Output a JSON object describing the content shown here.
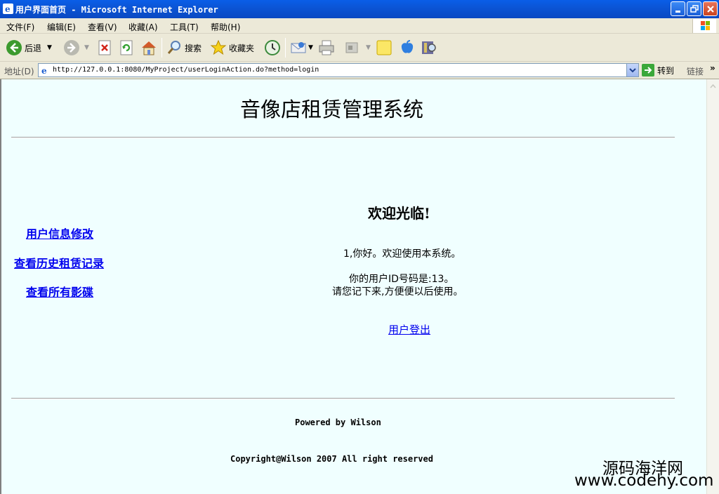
{
  "window": {
    "title": "用户界面首页 - Microsoft Internet Explorer"
  },
  "menu": {
    "items": [
      "文件(F)",
      "编辑(E)",
      "查看(V)",
      "收藏(A)",
      "工具(T)",
      "帮助(H)"
    ]
  },
  "toolbar": {
    "back_label": "后退",
    "search_label": "搜索",
    "favorites_label": "收藏夹"
  },
  "address": {
    "label": "地址(D)",
    "url": "http://127.0.0.1:8080/MyProject/userLoginAction.do?method=login",
    "go_label": "转到",
    "links_label": "链接",
    "links_chevron": "»"
  },
  "page": {
    "system_title": "音像店租赁管理系统",
    "welcome": "欢迎光临!",
    "nav": [
      "用户信息修改",
      "查看历史租赁记录",
      "查看所有影碟"
    ],
    "greeting": "1,你好。欢迎使用本系统。",
    "id_line": "你的用户ID号码是:13。",
    "remember_line": "请您记下来,方便便以后使用。",
    "logout": "用户登出",
    "powered": "Powered by Wilson",
    "copyright": "Copyright@Wilson 2007 All right reserved"
  },
  "watermark": {
    "line1": "源码海洋网",
    "line2": "www.codehy.com"
  }
}
